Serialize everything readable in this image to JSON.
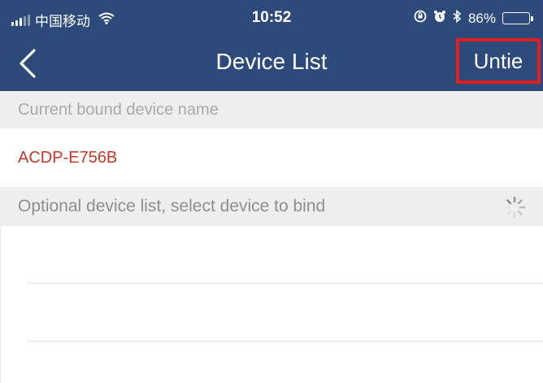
{
  "status_bar": {
    "carrier": "中国移动",
    "time": "10:52",
    "battery_percent": "86%",
    "battery_level": 0.86,
    "icons": [
      "signal-icon",
      "wifi-icon",
      "orientation-lock-icon",
      "alarm-icon",
      "bluetooth-icon",
      "battery-icon"
    ]
  },
  "nav": {
    "back_icon": "chevron-left-icon",
    "title": "Device List",
    "action_label": "Untie"
  },
  "bound_section": {
    "header": "Current bound device name",
    "device_name": "ACDP-E756B"
  },
  "optional_section": {
    "header": "Optional device list, select device to bind",
    "loading_icon": "spinner-icon"
  },
  "colors": {
    "nav_background": "#2e4a7a",
    "section_background": "#eeeeee",
    "device_name": "#c0392b",
    "highlight_box": "#e02020"
  }
}
